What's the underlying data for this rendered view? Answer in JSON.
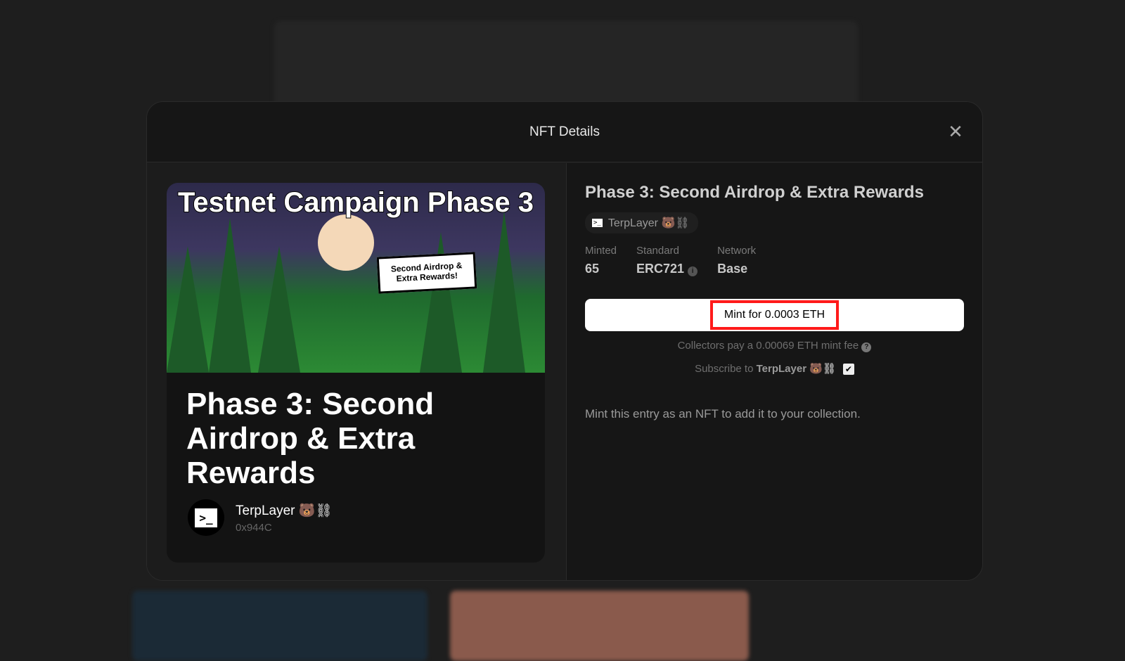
{
  "modal": {
    "title": "NFT Details"
  },
  "nft": {
    "art_title": "Testnet Campaign Phase 3",
    "art_bubble": "Second Airdrop & Extra Rewards!",
    "title": "Phase 3: Second Airdrop & Extra Rewards",
    "author": {
      "name": "TerpLayer 🐻⛓",
      "address": "0x944C",
      "avatar_glyph": ">_"
    },
    "stats": [
      {
        "label": "Minted",
        "value": "65"
      },
      {
        "label": "Standard",
        "value": "ERC721"
      },
      {
        "label": "Network",
        "value": "Base"
      }
    ],
    "mint_label": "Mint for 0.0003 ETH",
    "fee_text": "Collectors pay a 0.00069 ETH mint fee",
    "subscribe_prefix": "Subscribe to",
    "subscribe_name": "TerpLayer 🐻⛓",
    "subscribe_checked": true,
    "description": "Mint this entry as an NFT to add it to your collection."
  },
  "colors": {
    "highlight": "#ff1a1a",
    "modal_bg": "#161616"
  }
}
